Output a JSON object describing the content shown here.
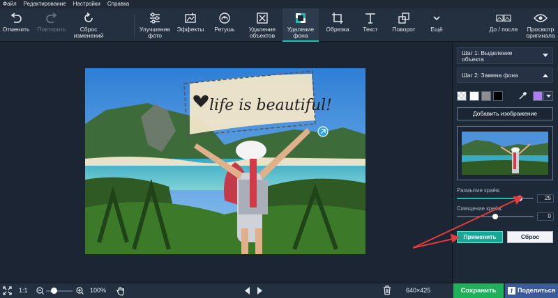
{
  "menu": [
    "Файл",
    "Редактирование",
    "Настройки",
    "Справка"
  ],
  "toolbar": {
    "undo": "Отменить",
    "redo": "Повторить",
    "reset_line1": "Сброс",
    "reset_line2": "изменений",
    "enhance_line1": "Улучшение",
    "enhance_line2": "фото",
    "effects": "Эффекты",
    "retouch": "Ретушь",
    "objremove_line1": "Удаление",
    "objremove_line2": "объектов",
    "bgremove_line1": "Удаление",
    "bgremove_line2": "фона",
    "crop": "Обрезка",
    "text": "Текст",
    "rotate": "Поворот",
    "more": "Ещё",
    "before_after": "До / после",
    "view_orig_line1": "Просмотр",
    "view_orig_line2": "оригинала"
  },
  "photo": {
    "caption": "life is beautiful!"
  },
  "sidebar": {
    "step1_line1": "Шаг 1: Выделение",
    "step1_line2": "объекта",
    "step2": "Шаг 2: Замена фона",
    "help": "?",
    "swatches": [
      "transparent",
      "#ffffff",
      "#8e8e8e",
      "#000000"
    ],
    "custom_color": "#b07cf2",
    "add_image": "Добавить изображение",
    "blur_label": "Размытие краёв:",
    "blur_value": "25",
    "blur_fraction": 0.82,
    "shift_label": "Смещение краёв:",
    "shift_value": "0",
    "shift_fraction": 0.5,
    "apply": "Применить",
    "reset": "Сброс"
  },
  "bottom": {
    "actual_size": "1:1",
    "zoom": "100%",
    "zoom_fraction": 0.3,
    "dimensions": "640×425",
    "save": "Сохранить",
    "share": "Поделиться"
  },
  "colors": {
    "accent": "#19c2b0",
    "save": "#21b05a",
    "share": "#3b5a9a",
    "annotation_arrow": "#e23c3c"
  },
  "icons": [
    "undo-icon",
    "redo-icon",
    "reset-icon",
    "enhance-icon",
    "effects-icon",
    "retouch-icon",
    "object-remove-icon",
    "background-remove-icon",
    "crop-icon",
    "text-icon",
    "rotate-icon",
    "chevron-down-icon",
    "before-after-icon",
    "eye-icon",
    "fit-screen-icon",
    "zoom-out-icon",
    "zoom-in-icon",
    "hand-icon",
    "prev-icon",
    "next-icon",
    "trash-icon",
    "eyedropper-icon",
    "facebook-icon"
  ]
}
